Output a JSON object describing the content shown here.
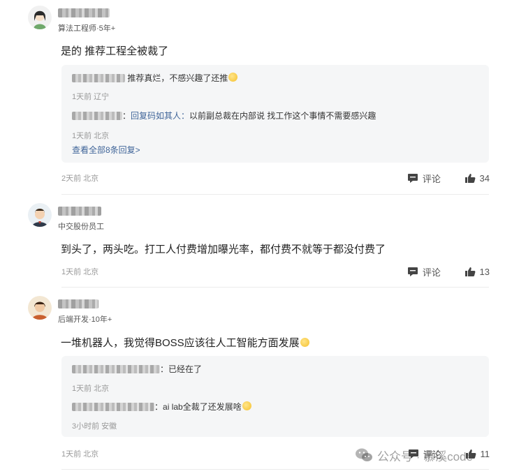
{
  "comments": [
    {
      "user_title": "算法工程师·5年+",
      "text": "是的 推荐工程全被裁了",
      "replies": [
        {
          "prefix": "",
          "reply_to": "",
          "text": "推荐真烂，不感兴趣了还推",
          "meta": "1天前 辽宁"
        },
        {
          "prefix": "：",
          "reply_to": "回复码如其人：",
          "text": "以前副总裁在内部说 找工作这个事情不需要感兴趣",
          "meta": "1天前 北京"
        }
      ],
      "view_all": "查看全部8条回复>",
      "meta": "2天前 北京",
      "comment_label": "评论",
      "likes": "34"
    },
    {
      "user_title": "中交股份员工",
      "text": "到头了，两头吃。打工人付费增加曝光率，都付费不就等于都没付费了",
      "meta": "1天前 北京",
      "comment_label": "评论",
      "likes": "13"
    },
    {
      "user_title": "后端开发·10年+",
      "text": "一堆机器人，我觉得BOSS应该往人工智能方面发展",
      "replies": [
        {
          "prefix": "：",
          "reply_to": "",
          "text": "已经在了",
          "meta": "1天前 北京"
        },
        {
          "prefix": "：",
          "reply_to": "",
          "text": "ai lab全裁了还发展啥",
          "meta": "3小时前 安徽"
        }
      ],
      "meta": "1天前 北京",
      "comment_label": "评论",
      "likes": "11"
    }
  ],
  "watermark": {
    "text": "公众号 · 慕溪code"
  },
  "colors": {
    "link": "#406599",
    "reply_bg": "#f5f6f7",
    "meta": "#999999"
  }
}
